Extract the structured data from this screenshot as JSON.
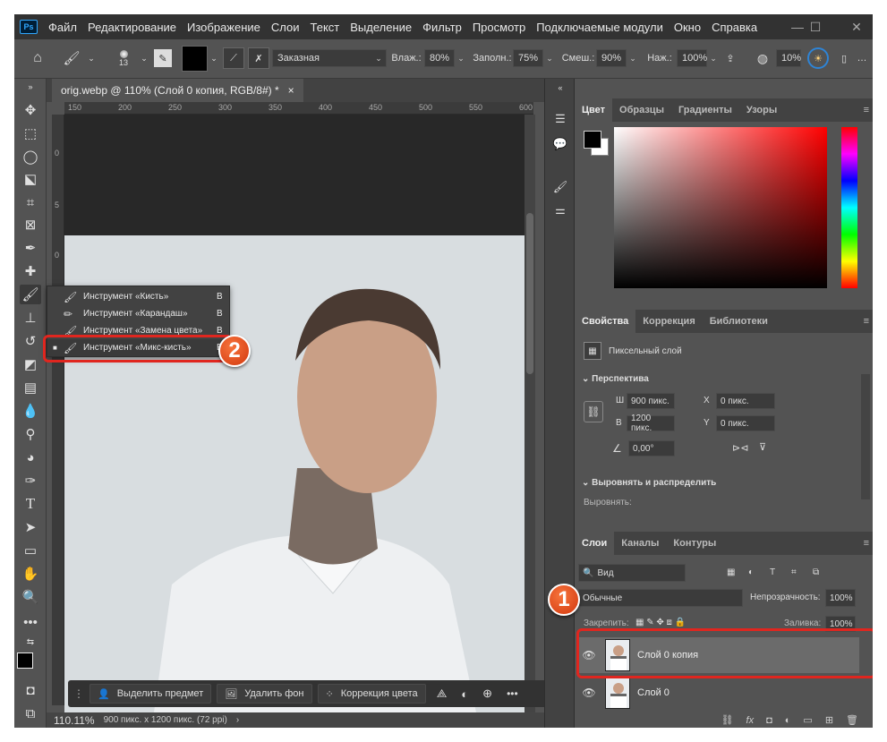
{
  "app": {
    "logo": "Ps",
    "menu": [
      "Файл",
      "Редактирование",
      "Изображение",
      "Слои",
      "Текст",
      "Выделение",
      "Фильтр",
      "Просмотр",
      "Подключаемые модули",
      "Окно",
      "Справка"
    ]
  },
  "options": {
    "brush_size": "13",
    "brush_preset": "Заказная",
    "wet_label": "Влаж.:",
    "wet_value": "80%",
    "load_label": "Заполн.:",
    "load_value": "75%",
    "mix_label": "Смеш.:",
    "mix_value": "90%",
    "flow_label": "Наж.:",
    "flow_value": "100%",
    "angle_value": "10%"
  },
  "document": {
    "tab_title": "orig.webp @ 110% (Слой 0 копия, RGB/8#) *",
    "close": "×"
  },
  "ruler": {
    "top": [
      "150",
      "200",
      "250",
      "300",
      "350",
      "400",
      "450",
      "500",
      "550",
      "600"
    ],
    "left": [
      "0",
      "5",
      "0"
    ]
  },
  "tool_popup": {
    "items": [
      {
        "label": "Инструмент «Кисть»",
        "key": "B",
        "icon": "brush-icon"
      },
      {
        "label": "Инструмент «Карандаш»",
        "key": "B",
        "icon": "pencil-icon"
      },
      {
        "label": "Инструмент «Замена цвета»",
        "key": "B",
        "icon": "color-replace-icon"
      },
      {
        "label": "Инструмент «Микс-кисть»",
        "key": "B",
        "icon": "mixer-brush-icon"
      }
    ]
  },
  "markers": {
    "one": "1",
    "two": "2"
  },
  "context_bar": {
    "select_subject": "Выделить предмет",
    "remove_bg": "Удалить фон",
    "color_correction": "Коррекция цвета",
    "more": "•••"
  },
  "status": {
    "zoom": "110.11%",
    "doc_info": "900 пикс. x 1200 пикс. (72 ppi)",
    "arrow": "›"
  },
  "color_panel": {
    "tabs": [
      "Цвет",
      "Образцы",
      "Градиенты",
      "Узоры"
    ],
    "fg_color": "#000000",
    "bg_color": "#ffffff",
    "picker_hue": "#ff0000"
  },
  "properties_panel": {
    "tabs": [
      "Свойства",
      "Коррекция",
      "Библиотеки"
    ],
    "layer_kind": "Пиксельный слой",
    "section_transform": "Перспектива",
    "w_label": "Ш",
    "w_value": "900 пикс.",
    "h_label": "В",
    "h_value": "1200 пикс.",
    "x_label": "X",
    "x_value": "0 пикс.",
    "y_label": "Y",
    "y_value": "0 пикс.",
    "angle_value": "0,00°",
    "section_align": "Выровнять и распределить",
    "align_label": "Выровнять:"
  },
  "layers_panel": {
    "tabs": [
      "Слои",
      "Каналы",
      "Контуры"
    ],
    "filter_label": "Вид",
    "blend_mode": "Обычные",
    "opacity_label": "Непрозрачность:",
    "opacity_value": "100%",
    "lock_label": "Закрепить:",
    "fill_label": "Заливка:",
    "fill_value": "100%",
    "layers": [
      {
        "name": "Слой 0 копия",
        "selected": true
      },
      {
        "name": "Слой 0",
        "selected": false
      }
    ]
  }
}
